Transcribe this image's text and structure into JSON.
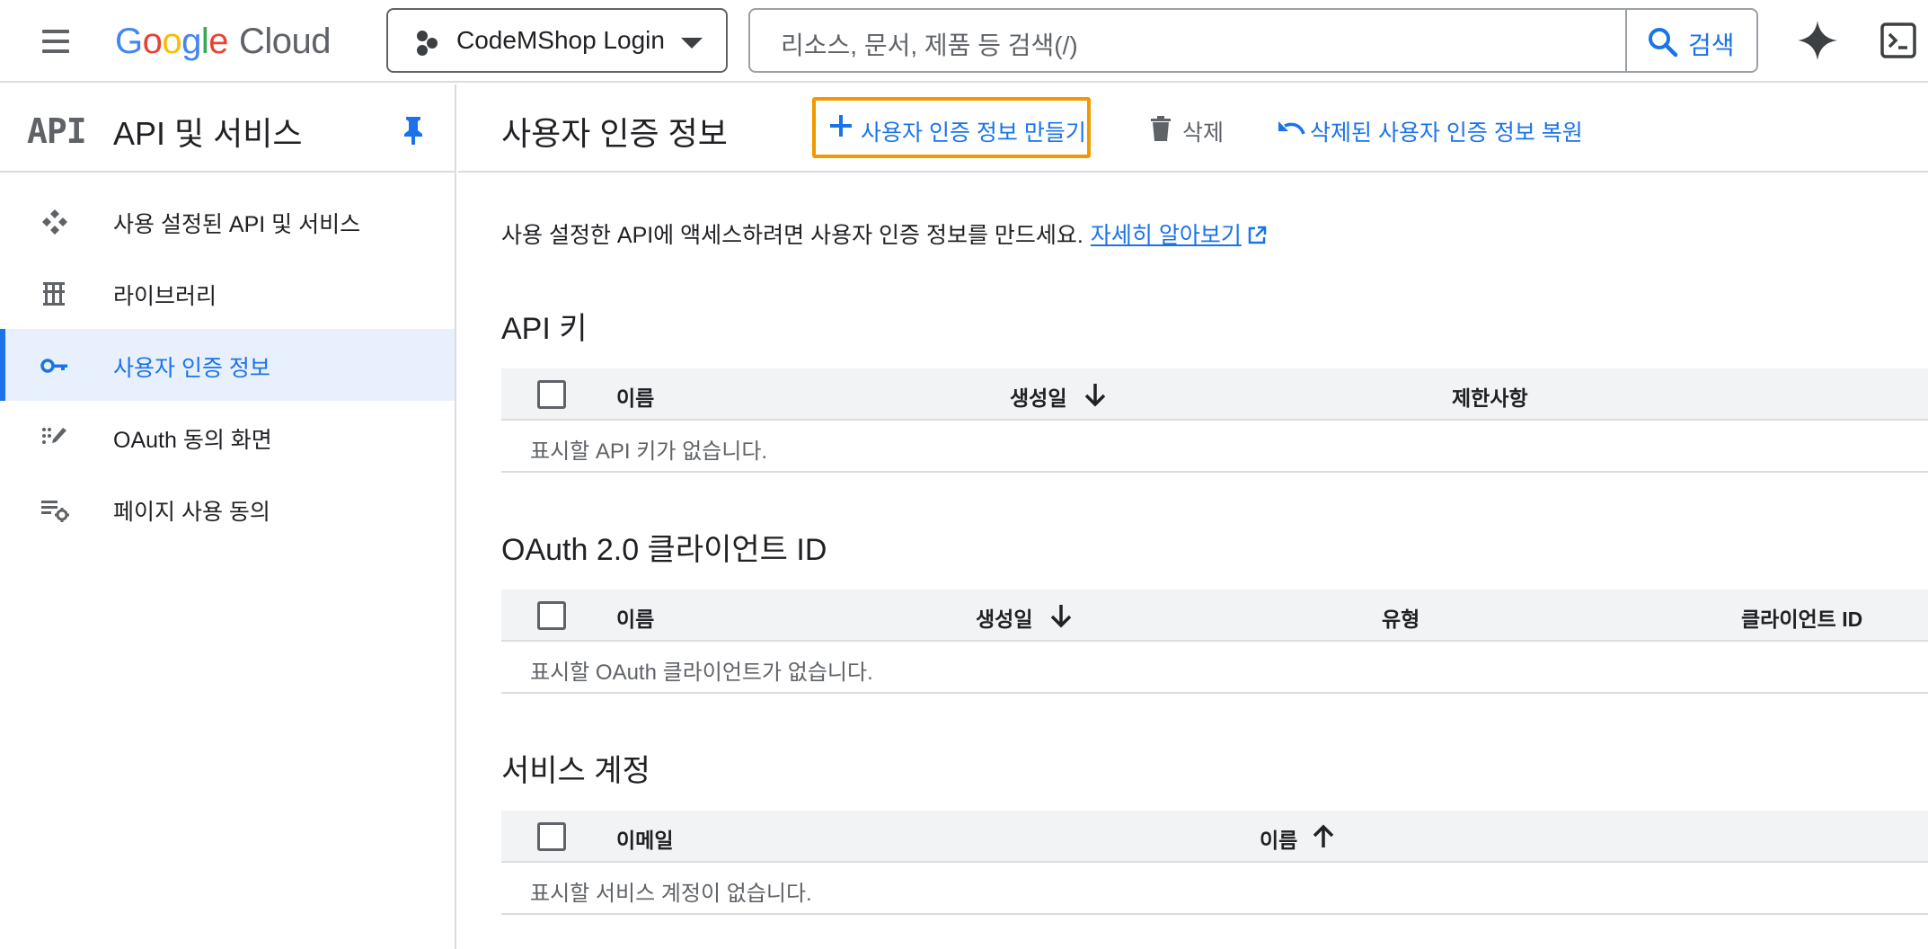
{
  "topbar": {
    "logo_google": [
      "G",
      "o",
      "o",
      "g",
      "l",
      "e"
    ],
    "logo_cloud": "Cloud",
    "project_name": "CodeMShop Login",
    "search_placeholder": "리소스, 문서, 제품 등 검색(/)",
    "search_button": "검색",
    "icons": [
      "menu-icon",
      "project-icon",
      "dropdown-icon",
      "search-icon",
      "gemini-icon",
      "cloud-shell-icon"
    ]
  },
  "sidebar": {
    "logo_text": "API",
    "title": "API 및 서비스",
    "items": [
      {
        "label": "사용 설정된 API 및 서비스",
        "icon": "enabled-apis-icon",
        "active": false
      },
      {
        "label": "라이브러리",
        "icon": "library-icon",
        "active": false
      },
      {
        "label": "사용자 인증 정보",
        "icon": "key-icon",
        "active": true
      },
      {
        "label": "OAuth 동의 화면",
        "icon": "oauth-consent-icon",
        "active": false
      },
      {
        "label": "페이지 사용 동의",
        "icon": "page-consent-icon",
        "active": false
      }
    ]
  },
  "toolbar": {
    "title": "사용자 인증 정보",
    "create_label": "사용자 인증 정보 만들기",
    "delete_label": "삭제",
    "restore_label": "삭제된 사용자 인증 정보 복원"
  },
  "content": {
    "intro_text": "사용 설정한 API에 액세스하려면 사용자 인증 정보를 만드세요.",
    "learn_more": "자세히 알아보기",
    "api_keys": {
      "title": "API 키",
      "columns": [
        "이름",
        "생성일",
        "제한사항"
      ],
      "empty": "표시할 API 키가 없습니다."
    },
    "oauth": {
      "title": "OAuth 2.0 클라이언트 ID",
      "columns": [
        "이름",
        "생성일",
        "유형",
        "클라이언트 ID"
      ],
      "empty": "표시할 OAuth 클라이언트가 없습니다."
    },
    "service_accounts": {
      "title": "서비스 계정",
      "columns": [
        "이메일",
        "이름"
      ],
      "empty": "표시할 서비스 계정이 없습니다."
    }
  },
  "colors": {
    "accent": "#1a73e8",
    "highlight_border": "#f29900",
    "active_bg": "#e8f0fe",
    "header_bg": "#f1f3f4"
  }
}
